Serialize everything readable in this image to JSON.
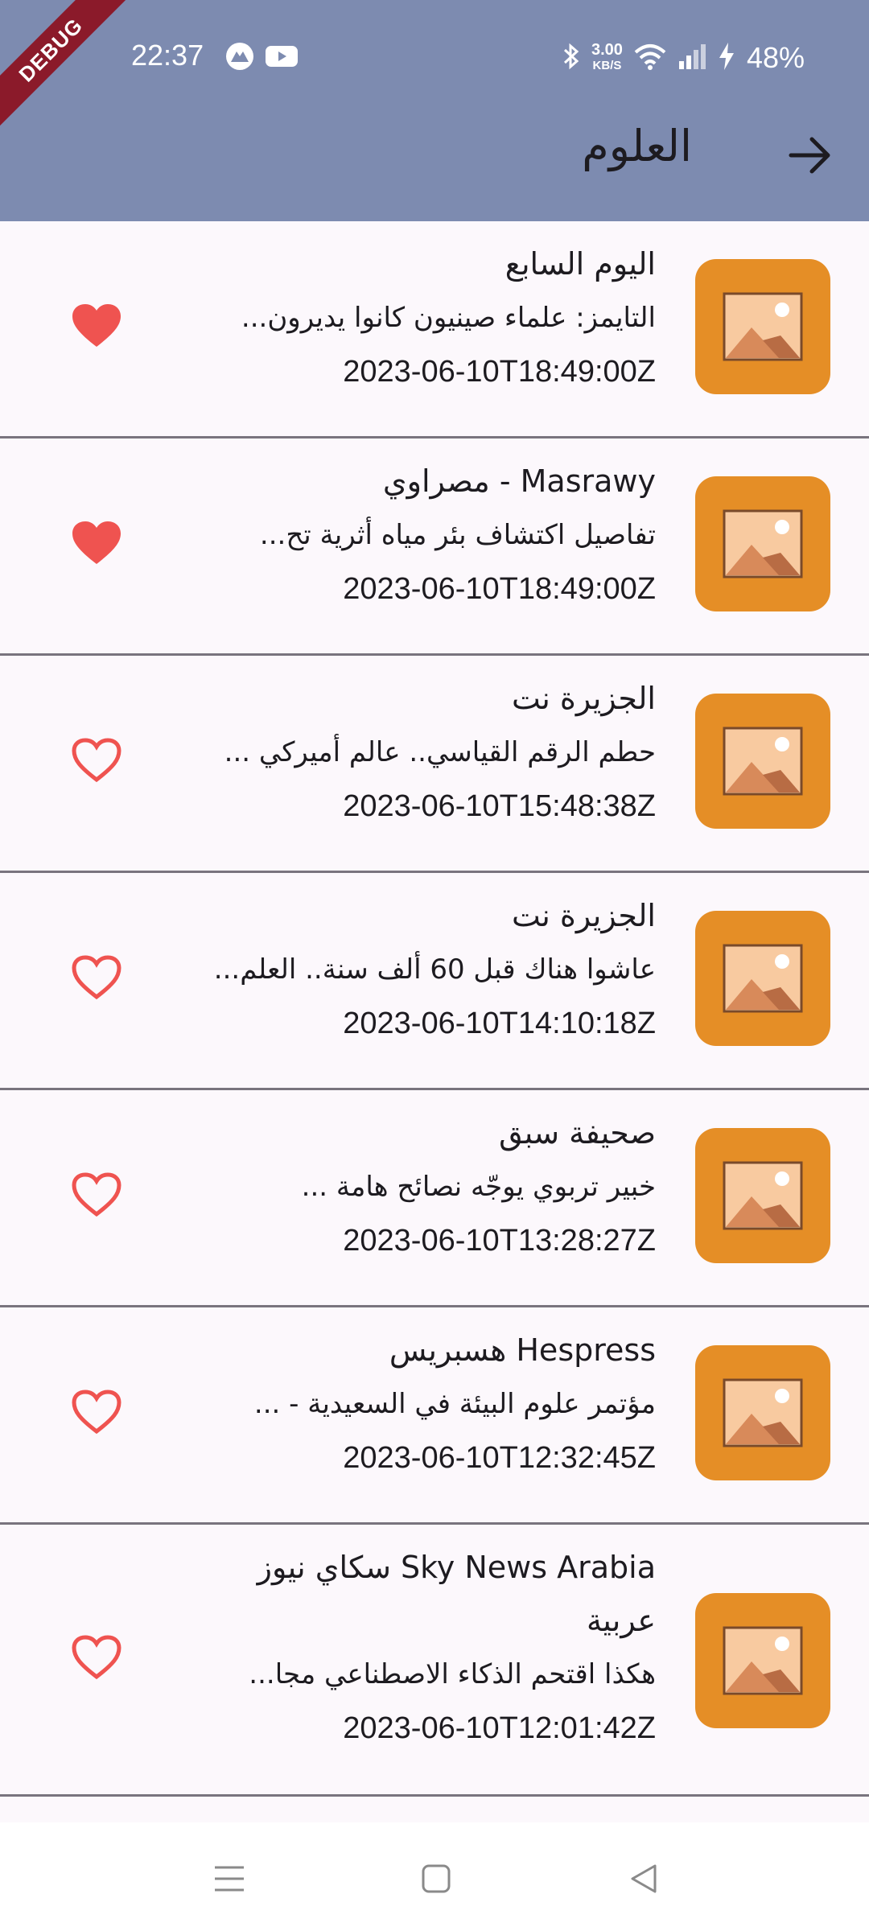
{
  "status_bar": {
    "time": "22:37",
    "net_speed_value": "3.00",
    "net_speed_unit": "KB/S",
    "battery": "48%"
  },
  "debug_banner": "DEBUG",
  "header": {
    "title": "العلوم"
  },
  "colors": {
    "app_bar": "#7d8bb0",
    "thumbnail": "#e58e26",
    "heart": "#ef5350",
    "divider": "#79747e"
  },
  "articles": [
    {
      "source": "اليوم السابع",
      "description": "التايمز: علماء صينيون كانوا يديرون...",
      "date": "2023-06-10T18:49:00Z",
      "favorite": true
    },
    {
      "source": "Masrawy - مصراوي",
      "description": "تفاصيل اكتشاف بئر مياه أثرية تح...",
      "date": "2023-06-10T18:49:00Z",
      "favorite": true
    },
    {
      "source": "الجزيرة نت",
      "description": "حطم الرقم القياسي.. عالم أميركي ...",
      "date": "2023-06-10T15:48:38Z",
      "favorite": false
    },
    {
      "source": "الجزيرة نت",
      "description": "عاشوا هناك قبل 60 ألف سنة.. العلم...",
      "date": "2023-06-10T14:10:18Z",
      "favorite": false
    },
    {
      "source": "صحيفة سبق",
      "description": "خبير تربوي يوجّه نصائح هامة ...",
      "date": "2023-06-10T13:28:27Z",
      "favorite": false
    },
    {
      "source": "Hespress هسبريس",
      "description": "مؤتمر علوم البيئة في السعيدية - ...",
      "date": "2023-06-10T12:32:45Z",
      "favorite": false
    },
    {
      "source": "Sky News Arabia سكاي نيوز عربية",
      "description": "هكذا اقتحم الذكاء الاصطناعي مجا...",
      "date": "2023-06-10T12:01:42Z",
      "favorite": false
    }
  ]
}
